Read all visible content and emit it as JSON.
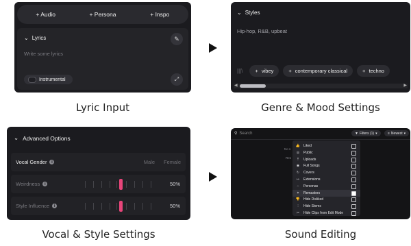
{
  "panel1": {
    "tags": [
      "+ Audio",
      "+ Persona",
      "+ Inspo"
    ],
    "lyrics_header": "Lyrics",
    "lyrics_placeholder": "Write some lyrics",
    "instrumental_label": "Instrumental",
    "caption": "Lyric Input"
  },
  "panel2": {
    "styles_header": "Styles",
    "styles_value": "Hip-hop, R&B, upbeat",
    "chips": [
      "vibey",
      "contemporary classical",
      "techno"
    ],
    "caption": "Genre & Mood Settings"
  },
  "panel3": {
    "header": "Advanced Options",
    "vocal_gender": {
      "label": "Vocal Gender",
      "options": [
        "Male",
        "Female"
      ]
    },
    "weirdness": {
      "label": "Weirdness",
      "value": "50%"
    },
    "style_influence": {
      "label": "Style Influence",
      "value": "50%"
    },
    "caption": "Vocal & Style Settings"
  },
  "panel4": {
    "search_placeholder": "Search",
    "filters_label": "Filters (1)",
    "sort_label": "Newest",
    "side_text": [
      "No s",
      "Res"
    ],
    "menu_items": [
      {
        "label": "Liked",
        "icon": "thumbs-up-icon",
        "glyph": "👍",
        "checked": false
      },
      {
        "label": "Public",
        "icon": "globe-icon",
        "glyph": "◎",
        "checked": false
      },
      {
        "label": "Uploads",
        "icon": "upload-icon",
        "glyph": "⤒",
        "checked": false
      },
      {
        "label": "Full Songs",
        "icon": "disc-icon",
        "glyph": "◉",
        "checked": false
      },
      {
        "label": "Covers",
        "icon": "cover-icon",
        "glyph": "↻",
        "checked": false
      },
      {
        "label": "Extensions",
        "icon": "extension-icon",
        "glyph": "↦",
        "checked": false
      },
      {
        "label": "Personas",
        "icon": "persona-icon",
        "glyph": "◌",
        "checked": false
      },
      {
        "label": "Remasters",
        "icon": "remaster-icon",
        "glyph": "✦",
        "checked": true
      },
      {
        "label": "Hide Disliked",
        "icon": "thumbs-down-icon",
        "glyph": "👎",
        "checked": false
      },
      {
        "label": "Hide Stems",
        "icon": "stems-icon",
        "glyph": "⫶",
        "checked": false
      },
      {
        "label": "Hide Clips from Edit Mode",
        "icon": "clip-icon",
        "glyph": "✂",
        "checked": false
      }
    ],
    "caption": "Sound Editing"
  }
}
